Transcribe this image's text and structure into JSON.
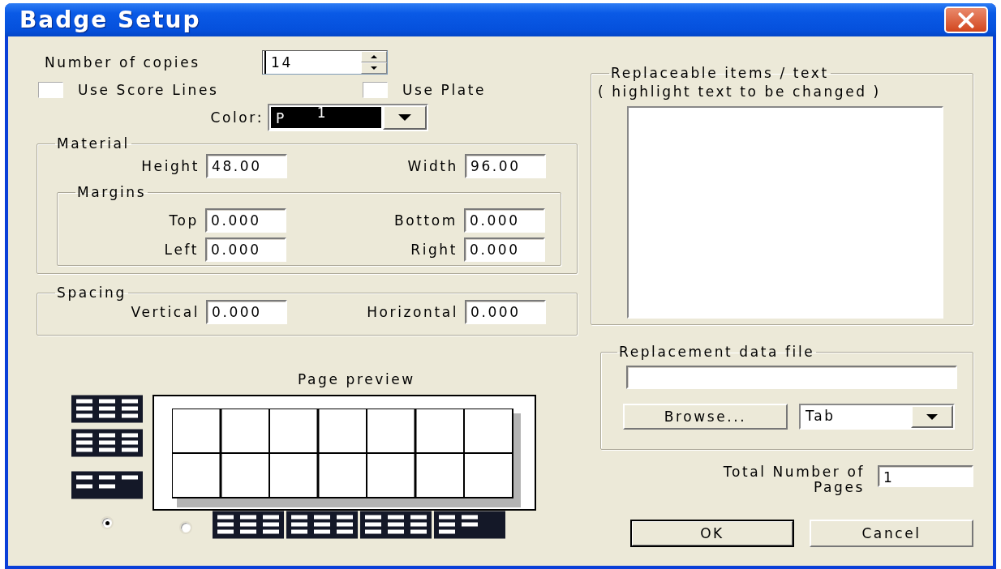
{
  "window": {
    "title": "Badge Setup"
  },
  "copies": {
    "label": "Number of copies",
    "value": "14"
  },
  "options": [
    {
      "label": "Use Score Lines",
      "checked": false
    },
    {
      "label": "Use Plate",
      "checked": false
    }
  ],
  "color": {
    "label": "Color:",
    "code": "P",
    "number": "1"
  },
  "material": {
    "legend": "Material",
    "fields": [
      {
        "label": "Height",
        "value": "48.00"
      },
      {
        "label": "Width",
        "value": "96.00"
      }
    ],
    "margins": {
      "legend": "Margins",
      "fields": [
        {
          "label": "Top",
          "value": "0.000"
        },
        {
          "label": "Bottom",
          "value": "0.000"
        },
        {
          "label": "Left",
          "value": "0.000"
        },
        {
          "label": "Right",
          "value": "0.000"
        }
      ]
    }
  },
  "spacing": {
    "legend": "Spacing",
    "fields": [
      {
        "label": "Vertical",
        "value": "0.000"
      },
      {
        "label": "Horizontal",
        "value": "0.000"
      }
    ]
  },
  "preview": {
    "title": "Page preview"
  },
  "layout_options": [
    {
      "selected": true
    },
    {
      "selected": false
    }
  ],
  "replaceable": {
    "legend": "Replaceable items / text",
    "hint": "( highlight text to be changed )"
  },
  "data_file": {
    "legend": "Replacement data file",
    "browse": "Browse...",
    "delimiter": "Tab"
  },
  "total_pages": {
    "label": "Total Number of Pages",
    "value": "1"
  },
  "buttons": [
    {
      "label": "OK",
      "default": true
    },
    {
      "label": "Cancel",
      "default": false
    }
  ]
}
